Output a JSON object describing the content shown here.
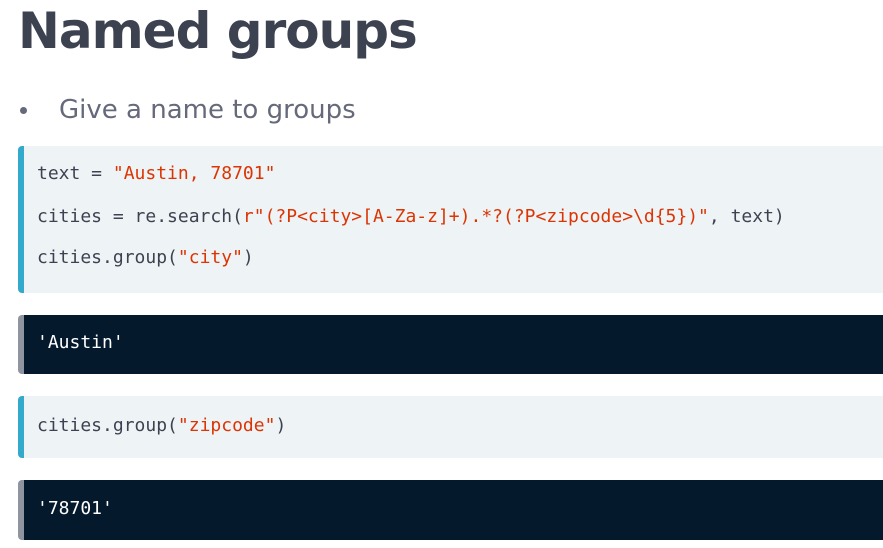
{
  "title": "Named groups",
  "bullets": [
    "Give a name to groups"
  ],
  "code_block_1": {
    "line1": {
      "pre": "text = ",
      "str": "\"Austin, 78701\""
    },
    "line2": {
      "pre": "cities = re.search(",
      "str": "r\"(?P<city>[A-Za-z]+).*?(?P<zipcode>\\d{5})\"",
      "post": ", text)"
    },
    "line3": {
      "pre": "cities.group(",
      "str": "\"city\"",
      "post": ")"
    }
  },
  "output_1": "'Austin'",
  "code_block_2": {
    "line1": {
      "pre": "cities.group(",
      "str": "\"zipcode\"",
      "post": ")"
    }
  },
  "output_2": "'78701'",
  "colors": {
    "code_accent": "#33aacc",
    "code_bg": "#eef3f6",
    "output_bg": "#05192d",
    "string": "#dd3403"
  }
}
